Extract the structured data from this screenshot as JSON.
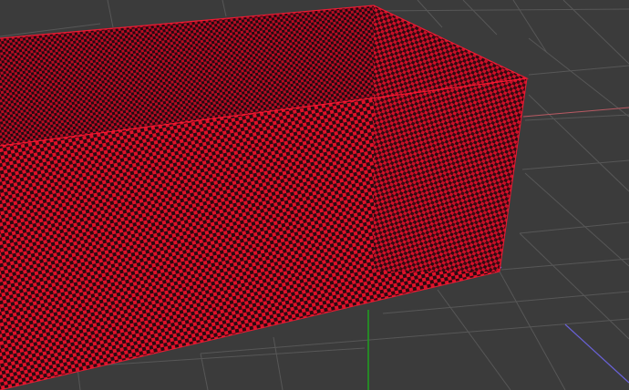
{
  "viewport": {
    "background_color": "#3b3b3b",
    "grid_color": "#565656",
    "grid_highlight_color": "#6a6a6a"
  },
  "axes": {
    "x_axis_color": "#b85a63",
    "y_axis_color": "#1fa11f",
    "z_axis_color": "#6a62d8"
  },
  "object": {
    "shape": "open-box",
    "material": "checker",
    "checker_primary_color": "#e0112a",
    "checker_secondary_color": "#2a0a10",
    "inner_shade_color": "#5a0814"
  }
}
